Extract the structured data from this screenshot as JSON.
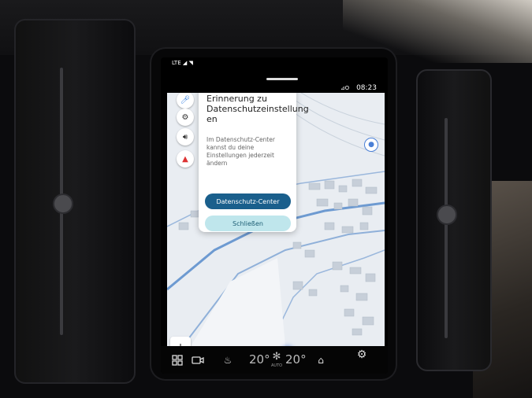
{
  "statusbar": {
    "network": "LTE ◢ ◥",
    "indicators": "⊿O",
    "time": "08:23"
  },
  "popup": {
    "title": "Erinnerung zu Datenschutzeinstellung en",
    "text": "Im Datenschutz-Center kannst du deine Einstellungen jederzeit ändern",
    "primary_button": "Datenschutz-Center",
    "secondary_button": "Schließen"
  },
  "map_controls": {
    "zoom_in": "+",
    "zoom_out": "−"
  },
  "bottombar": {
    "temp_left": "20°",
    "temp_right": "20°",
    "fan_mode": "AUTO"
  },
  "colors": {
    "primary_button": "#1a5f8c",
    "secondary_button": "#bfe6ec",
    "map_background": "#e7ebf0",
    "location_dot": "#1f5bd6"
  }
}
